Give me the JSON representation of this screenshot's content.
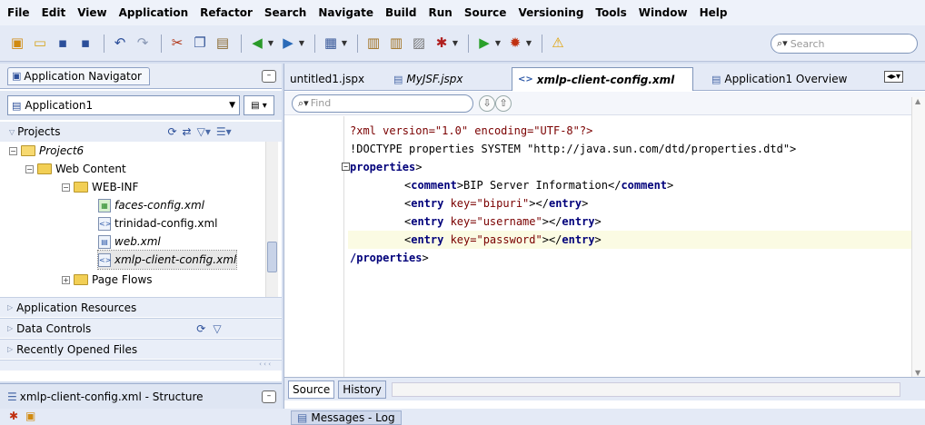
{
  "menu": [
    "File",
    "Edit",
    "View",
    "Application",
    "Refactor",
    "Search",
    "Navigate",
    "Build",
    "Run",
    "Source",
    "Versioning",
    "Tools",
    "Window",
    "Help"
  ],
  "toolbar": {
    "search_placeholder": "Search"
  },
  "navigator": {
    "tab_label": "Application Navigator",
    "application": "Application1",
    "projects_header": "Projects",
    "tree": [
      {
        "label": "Project6"
      },
      {
        "label": "Web Content"
      },
      {
        "label": "WEB-INF"
      },
      {
        "label": "faces-config.xml"
      },
      {
        "label": "trinidad-config.xml"
      },
      {
        "label": "web.xml"
      },
      {
        "label": "xmlp-client-config.xml"
      },
      {
        "label": "Page Flows"
      }
    ],
    "accordions": [
      "Application Resources",
      "Data Controls",
      "Recently Opened Files"
    ]
  },
  "structure": {
    "tab_label": "xmlp-client-config.xml - Structure"
  },
  "editor": {
    "tabs": [
      "untitled1.jspx",
      "MyJSF.jspx",
      "xmlp-client-config.xml",
      "Application1 Overview"
    ],
    "find_placeholder": "Find",
    "code": {
      "l1": "?xml version=\"1.0\" encoding=\"UTF-8\"?>",
      "l2": "!DOCTYPE properties SYSTEM \"http://java.sun.com/dtd/properties.dtd\">",
      "l3_tag": "properties",
      "l4_text": "BIP Server Information",
      "key1": "\"bipuri\"",
      "key2": "\"username\"",
      "key3": "\"password\"",
      "l8_tag": "/properties"
    },
    "bottom_tabs": [
      "Source",
      "History"
    ]
  },
  "messages": {
    "label": "Messages - Log"
  }
}
